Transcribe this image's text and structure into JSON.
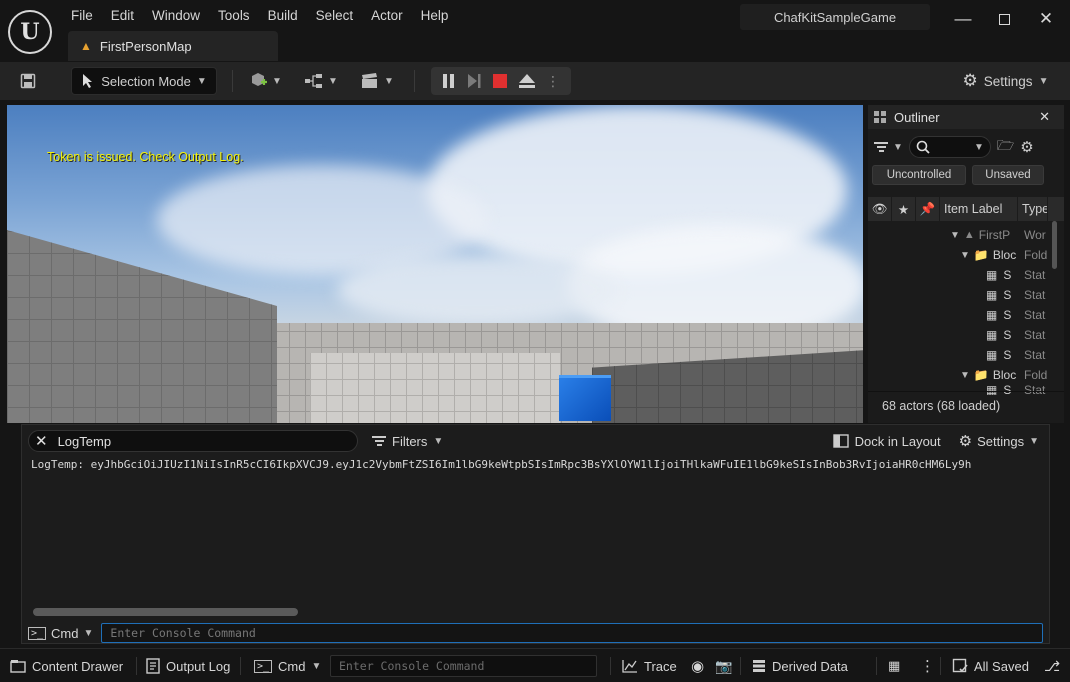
{
  "menu": {
    "items": [
      "File",
      "Edit",
      "Window",
      "Tools",
      "Build",
      "Select",
      "Actor",
      "Help"
    ]
  },
  "project_name": "ChafKitSampleGame",
  "map_tab": {
    "label": "FirstPersonMap"
  },
  "toolbar": {
    "selection_mode_label": "Selection Mode",
    "settings_label": "Settings"
  },
  "viewport": {
    "message": "Token is issued. Check Output Log."
  },
  "outliner": {
    "title": "Outliner",
    "chip_uncontrolled": "Uncontrolled",
    "chip_unsaved": "Unsaved",
    "col_item_label": "Item Label",
    "col_type": "Type",
    "rows": [
      {
        "label": "FirstP",
        "type": "Wor"
      },
      {
        "label": "Bloc",
        "type": "Fold"
      },
      {
        "label": "S",
        "type": "Stat"
      },
      {
        "label": "S",
        "type": "Stat"
      },
      {
        "label": "S",
        "type": "Stat"
      },
      {
        "label": "S",
        "type": "Stat"
      },
      {
        "label": "S",
        "type": "Stat"
      },
      {
        "label": "Bloc",
        "type": "Fold"
      },
      {
        "label": "S",
        "type": "Stat"
      }
    ],
    "footer": "68 actors (68 loaded)"
  },
  "output_log": {
    "search_value": "LogTemp",
    "filters_label": "Filters",
    "dock_label": "Dock in Layout",
    "settings_label": "Settings",
    "line": "LogTemp: eyJhbGciOiJIUzI1NiIsInR5cCI6IkpXVCJ9.eyJ1c2VybmFtZSI6Im1lbG9keWtpbSIsImRpc3BsYXlOYW1lIjoiTHlkaWFuIE1lbG9keSIsInBob3RvIjoiaHR0cHM6Ly9h",
    "cmd_label": "Cmd",
    "cmd_placeholder": "Enter Console Command"
  },
  "statusbar": {
    "content_drawer": "Content Drawer",
    "output_log": "Output Log",
    "cmd_label": "Cmd",
    "cmd_placeholder": "Enter Console Command",
    "trace": "Trace",
    "derived_data": "Derived Data",
    "all_saved": "All Saved"
  },
  "colors": {
    "accent_blue": "#1f6fb8",
    "viewport_message": "#f2f20a",
    "stop_red": "#e03030",
    "folder": "#e8a230"
  }
}
